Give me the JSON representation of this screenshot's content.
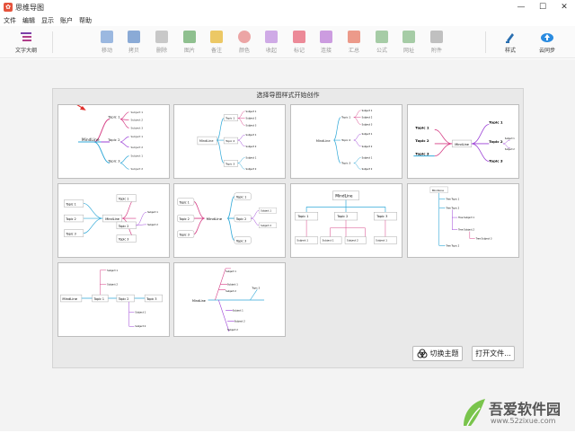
{
  "window": {
    "title": "思维导图",
    "app_icon": "mindmap-app-icon",
    "min": "—",
    "max": "☐",
    "close": "✕"
  },
  "menu": [
    "文件",
    "编辑",
    "显示",
    "账户",
    "帮助"
  ],
  "toolbar": {
    "outline": {
      "label": "文字大纲",
      "icon": "outline-icon"
    },
    "tools": [
      {
        "label": "移动",
        "icon": "move-icon",
        "color": "#9bb8e0"
      },
      {
        "label": "拷贝",
        "icon": "copy-icon",
        "color": "#8aaad6"
      },
      {
        "label": "删除",
        "icon": "delete-icon",
        "color": "#b8b8b8"
      },
      {
        "label": "图片",
        "icon": "image-icon",
        "color": "#7fb37f"
      },
      {
        "label": "备注",
        "icon": "note-icon",
        "color": "#e8c35a"
      },
      {
        "label": "颜色",
        "icon": "palette-icon",
        "color": "#e89a9a"
      },
      {
        "label": "收起",
        "icon": "collapse-icon",
        "color": "#c6a0e0"
      },
      {
        "label": "标记",
        "icon": "flag-icon",
        "color": "#e87a8a"
      },
      {
        "label": "连接",
        "icon": "connect-icon",
        "color": "#c490d8"
      },
      {
        "label": "汇总",
        "icon": "summary-icon",
        "color": "#e88a7a"
      },
      {
        "label": "公式",
        "icon": "formula-icon",
        "color": "#9ac49a"
      },
      {
        "label": "网址",
        "icon": "link-icon",
        "color": "#9ac49a"
      },
      {
        "label": "附件",
        "icon": "attachment-icon",
        "color": "#b0b0b0"
      }
    ],
    "style": {
      "label": "样式",
      "icon": "brush-icon"
    },
    "sync": {
      "label": "云同步",
      "icon": "cloud-upload-icon"
    }
  },
  "panel": {
    "title": "选择导图样式开始创作",
    "switch_theme": "切换主题",
    "open_file": "打开文件..."
  },
  "map": {
    "root": "MindLine",
    "topic1": "Topic 1",
    "topic2": "Topic 2",
    "topic3": "Topic 3",
    "subject1": "Subject 1",
    "subject2": "Subject 2",
    "subject3": "Subject 3",
    "tree_topic1": "Tree Topic 1",
    "tree_topic2": "Tree Topic 2",
    "tree_subject1": "Tree Subject 1",
    "tree_subject2": "Tree Subject 2",
    "tree_subject3": "Tree Subject 3"
  },
  "colors": {
    "pink": "#d63f86",
    "purple": "#9b3fd6",
    "cyan": "#31a9d8",
    "accent": "#3a86c8",
    "arrow": "#e0302c"
  },
  "watermark": {
    "brand": "吾爱软件园",
    "url": "www.52zixue.com"
  }
}
